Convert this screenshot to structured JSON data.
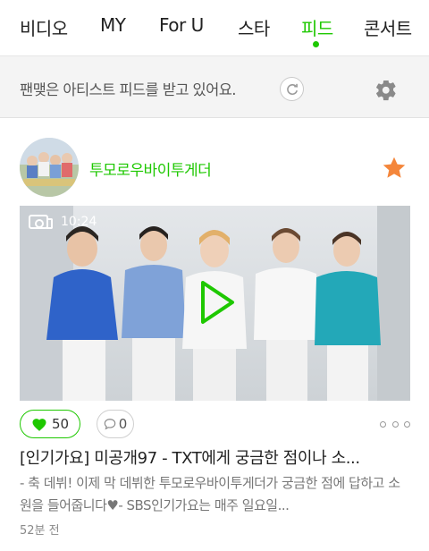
{
  "nav": {
    "tabs": [
      {
        "label": "비디오"
      },
      {
        "label": "MY"
      },
      {
        "label": "For U"
      },
      {
        "label": "스타"
      },
      {
        "label": "피드"
      },
      {
        "label": "콘서트"
      }
    ],
    "active_tab": "피드",
    "accent_color": "#1ec800"
  },
  "info_bar": {
    "text": "팬맺은 아티스트 피드를 받고 있어요.",
    "refresh_icon": "refresh-icon",
    "settings_icon": "gear-icon"
  },
  "feed_item": {
    "artist_name": "투모로우바이투게더",
    "favorite_icon": "star-icon",
    "favorite_color": "#f4863b",
    "video": {
      "badge_icon": "video-camera-icon",
      "duration": "10:24",
      "play_icon": "play-icon"
    },
    "likes": "50",
    "comments": "0",
    "title": "[인기가요] 미공개97 - TXT에게 궁금한 점이나 소...",
    "description": "- 축 데뷔! 이제 막 데뷔한 투모로우바이투게더가 궁금한 점에 답하고 소원을 들어줍니다♥- SBS인기가요는 매주 일요일...",
    "time": "52분 전"
  }
}
